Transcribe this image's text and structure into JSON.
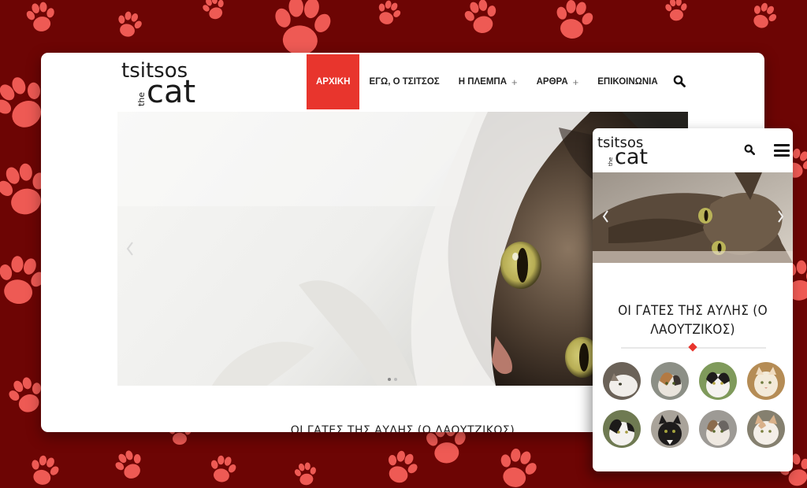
{
  "brand": {
    "line1": "tsitsos",
    "line2": "the",
    "line3": "cat"
  },
  "nav": {
    "items": [
      {
        "label": "ΑΡΧΙΚΗ",
        "active": true,
        "has_submenu": false
      },
      {
        "label": "ΕΓΩ, Ο ΤΣΙΤΣΟΣ",
        "active": false,
        "has_submenu": false
      },
      {
        "label": "Η ΠΛΕΜΠΑ",
        "active": false,
        "has_submenu": true
      },
      {
        "label": "ΑΡΘΡΑ",
        "active": false,
        "has_submenu": true
      },
      {
        "label": "ΕΠΙΚΟΙΝΩΝΙΑ",
        "active": false,
        "has_submenu": false
      }
    ],
    "submenu_symbol": "+"
  },
  "icons": {
    "search": "search-icon",
    "menu": "hamburger-menu-icon",
    "prev": "chevron-left-icon",
    "next": "chevron-right-icon"
  },
  "hero": {
    "image": "tabby-cat-under-white-blanket",
    "slider_dots": 2,
    "active_dot": 1
  },
  "section": {
    "title": "ΟΙ ΓΑΤΕΣ ΤΗΣ ΑΥΛΗΣ (Ο ΛΑΟΥΤΖΙΚΟΣ)"
  },
  "mobile": {
    "title_line1": "ΟΙ ΓΑΤΕΣ ΤΗΣ ΑΥΛΗΣ (Ο",
    "title_line2": "ΛΑΟΥΤΖΙΚΟΣ)",
    "hero_image": "tabby-cat-lying",
    "cat_thumbnails": [
      "white-tabby-cat",
      "calico-cat",
      "black-white-cat",
      "cream-cat",
      "black-white-cat-2",
      "black-cat",
      "tabby-white-cat",
      "cream-white-cat"
    ]
  },
  "colors": {
    "accent": "#e8352d",
    "background": "#6d0504",
    "paw": "#ef5a54"
  }
}
